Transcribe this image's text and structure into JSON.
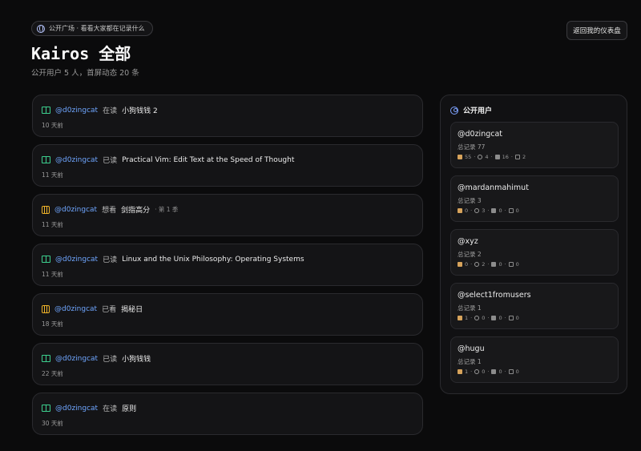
{
  "header": {
    "pill": "公开广场 · 看看大家都在记录什么",
    "back_button": "返回我的仪表盘",
    "title": "Kairos 全部",
    "subtitle": "公开用户 5 人，首屏动态 20 条"
  },
  "feed": [
    {
      "icon": "book",
      "user": "@d0zingcat",
      "verb": "在读",
      "title": "小狗钱钱 2",
      "extra": "",
      "time": "10 天前"
    },
    {
      "icon": "book",
      "user": "@d0zingcat",
      "verb": "已读",
      "title": "Practical Vim: Edit Text at the Speed of Thought",
      "extra": "",
      "time": "11 天前"
    },
    {
      "icon": "film",
      "user": "@d0zingcat",
      "verb": "想看",
      "title": "剑指高分",
      "extra": "· 第 1 季",
      "time": "11 天前"
    },
    {
      "icon": "book",
      "user": "@d0zingcat",
      "verb": "已读",
      "title": "Linux and the Unix Philosophy: Operating Systems",
      "extra": "",
      "time": "11 天前"
    },
    {
      "icon": "film",
      "user": "@d0zingcat",
      "verb": "已看",
      "title": "揭秘日",
      "extra": "",
      "time": "18 天前"
    },
    {
      "icon": "book",
      "user": "@d0zingcat",
      "verb": "已读",
      "title": "小狗钱钱",
      "extra": "",
      "time": "22 天前"
    },
    {
      "icon": "book",
      "user": "@d0zingcat",
      "verb": "在读",
      "title": "原则",
      "extra": "",
      "time": "30 天前"
    }
  ],
  "sidebar": {
    "title": "公开用户",
    "users": [
      {
        "name": "@d0zingcat",
        "count": "总记录 77",
        "books": "55",
        "music": "4",
        "films": "16",
        "games": "2"
      },
      {
        "name": "@mardanmahimut",
        "count": "总记录 3",
        "books": "0",
        "music": "3",
        "films": "0",
        "games": "0"
      },
      {
        "name": "@xyz",
        "count": "总记录 2",
        "books": "0",
        "music": "2",
        "films": "0",
        "games": "0"
      },
      {
        "name": "@select1fromusers",
        "count": "总记录 1",
        "books": "1",
        "music": "0",
        "films": "0",
        "games": "0"
      },
      {
        "name": "@hugu",
        "count": "总记录 1",
        "books": "1",
        "music": "0",
        "films": "0",
        "games": "0"
      }
    ]
  },
  "colors": {
    "accent_user": "#6fa6ff",
    "book_icon": "#3ccf8e",
    "film_icon": "#f0b429"
  }
}
